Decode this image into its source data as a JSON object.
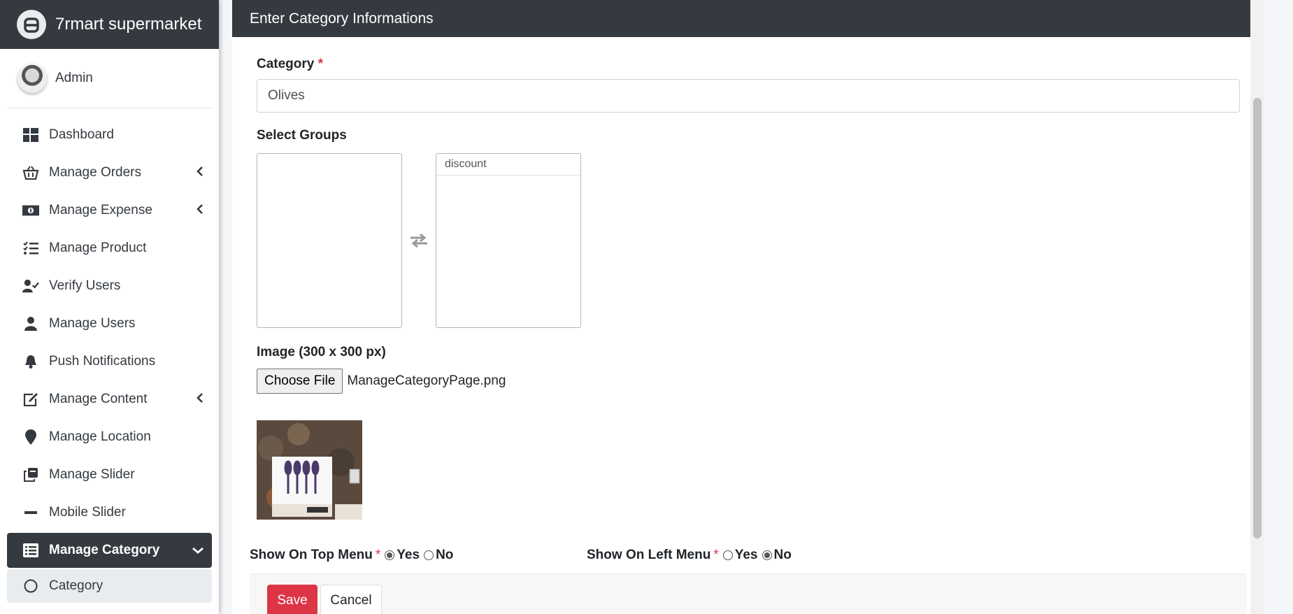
{
  "app": {
    "title": "7rmart supermarket"
  },
  "user": {
    "name": "Admin"
  },
  "sidebar": {
    "items": [
      {
        "label": "Dashboard",
        "icon": "dashboard-icon"
      },
      {
        "label": "Manage Orders",
        "icon": "basket-icon"
      },
      {
        "label": "Manage Expense",
        "icon": "money-icon"
      },
      {
        "label": "Manage Product",
        "icon": "tasks-icon"
      },
      {
        "label": "Verify Users",
        "icon": "user-check-icon"
      },
      {
        "label": "Manage Users",
        "icon": "user-icon"
      },
      {
        "label": "Push Notifications",
        "icon": "bell-icon"
      },
      {
        "label": "Manage Content",
        "icon": "edit-icon"
      },
      {
        "label": "Manage Location",
        "icon": "map-marker-icon"
      },
      {
        "label": "Manage Slider",
        "icon": "copy-icon"
      },
      {
        "label": "Mobile Slider",
        "icon": "minus-icon"
      },
      {
        "label": "Manage Category",
        "icon": "list-icon"
      },
      {
        "label": "Category",
        "icon": "circle-icon"
      }
    ]
  },
  "form": {
    "header": "Enter Category Informations",
    "category_label": "Category",
    "required_mark": "*",
    "category_value": "Olives",
    "groups_label": "Select Groups",
    "selected_groups": [
      "discount"
    ],
    "image_label": "Image (300 x 300 px)",
    "choose_file_label": "Choose File",
    "file_name": "ManageCategoryPage.png",
    "top_menu_label": "Show On Top Menu",
    "left_menu_label": "Show On Left Menu",
    "yes_label": "Yes",
    "no_label": "No",
    "top_menu_value": "Yes",
    "left_menu_value": "No",
    "save_label": "Save",
    "cancel_label": "Cancel"
  },
  "colors": {
    "dark": "#343a40",
    "danger": "#dc3545",
    "sub_active": "#e9ecef"
  }
}
